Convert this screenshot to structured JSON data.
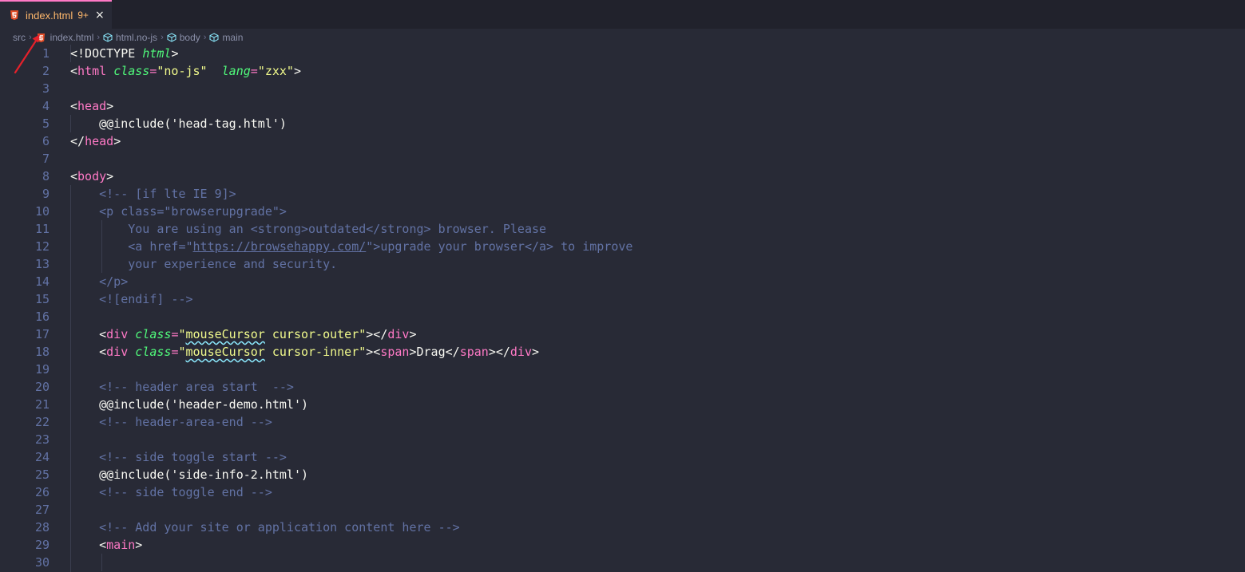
{
  "tab": {
    "label": "index.html",
    "badge": "9+",
    "close": "×"
  },
  "breadcrumb": {
    "items": [
      "src",
      "index.html",
      "html.no-js",
      "body",
      "main"
    ]
  },
  "colors": {
    "accent": "#ff79c6",
    "tab_text": "#ffb86c",
    "background": "#282a36",
    "arrow": "#e5212b"
  },
  "editor": {
    "lines": [
      [
        {
          "t": "<!DOCTYPE ",
          "c": "pun"
        },
        {
          "t": "html",
          "c": "doct"
        },
        {
          "t": ">",
          "c": "pun"
        }
      ],
      [
        {
          "t": "<",
          "c": "pun"
        },
        {
          "t": "html",
          "c": "tag"
        },
        {
          "t": " ",
          "c": "pun"
        },
        {
          "t": "class",
          "c": "attr"
        },
        {
          "t": "=",
          "c": "tag"
        },
        {
          "t": "\"no-js\"",
          "c": "str"
        },
        {
          "t": "  ",
          "c": "pun"
        },
        {
          "t": "lang",
          "c": "attr"
        },
        {
          "t": "=",
          "c": "tag"
        },
        {
          "t": "\"zxx\"",
          "c": "str"
        },
        {
          "t": ">",
          "c": "pun"
        }
      ],
      [],
      [
        {
          "t": "<",
          "c": "pun"
        },
        {
          "t": "head",
          "c": "tag"
        },
        {
          "t": ">",
          "c": "pun"
        }
      ],
      [
        {
          "t": "    @@include('head-tag.html')",
          "c": "plain"
        }
      ],
      [
        {
          "t": "</",
          "c": "pun"
        },
        {
          "t": "head",
          "c": "tag"
        },
        {
          "t": ">",
          "c": "pun"
        }
      ],
      [],
      [
        {
          "t": "<",
          "c": "pun"
        },
        {
          "t": "body",
          "c": "tag"
        },
        {
          "t": ">",
          "c": "pun"
        }
      ],
      [
        {
          "t": "    <!-- [if lte IE 9]>",
          "c": "com"
        }
      ],
      [
        {
          "t": "    <p class=\"browserupgrade\">",
          "c": "com"
        }
      ],
      [
        {
          "t": "        You are using an <strong>outdated</strong> browser. Please",
          "c": "com"
        }
      ],
      [
        {
          "t": "        <a href=\"",
          "c": "com"
        },
        {
          "t": "https://browsehappy.com/",
          "c": "link"
        },
        {
          "t": "\">upgrade your browser</a> to improve",
          "c": "com"
        }
      ],
      [
        {
          "t": "        your experience and security.",
          "c": "com"
        }
      ],
      [
        {
          "t": "    </p>",
          "c": "com"
        }
      ],
      [
        {
          "t": "    <![endif] -->",
          "c": "com"
        }
      ],
      [],
      [
        {
          "t": "    <",
          "c": "pun"
        },
        {
          "t": "div",
          "c": "tag"
        },
        {
          "t": " ",
          "c": "pun"
        },
        {
          "t": "class",
          "c": "attr"
        },
        {
          "t": "=",
          "c": "tag"
        },
        {
          "t": "\"",
          "c": "str"
        },
        {
          "t": "mouseCursor",
          "c": "str squig"
        },
        {
          "t": " cursor-outer\"",
          "c": "str"
        },
        {
          "t": "></",
          "c": "pun"
        },
        {
          "t": "div",
          "c": "tag"
        },
        {
          "t": ">",
          "c": "pun"
        }
      ],
      [
        {
          "t": "    <",
          "c": "pun"
        },
        {
          "t": "div",
          "c": "tag"
        },
        {
          "t": " ",
          "c": "pun"
        },
        {
          "t": "class",
          "c": "attr"
        },
        {
          "t": "=",
          "c": "tag"
        },
        {
          "t": "\"",
          "c": "str"
        },
        {
          "t": "mouseCursor",
          "c": "str squig"
        },
        {
          "t": " cursor-inner\"",
          "c": "str"
        },
        {
          "t": "><",
          "c": "pun"
        },
        {
          "t": "span",
          "c": "tag"
        },
        {
          "t": ">Drag</",
          "c": "pun"
        },
        {
          "t": "span",
          "c": "tag"
        },
        {
          "t": "></",
          "c": "pun"
        },
        {
          "t": "div",
          "c": "tag"
        },
        {
          "t": ">",
          "c": "pun"
        }
      ],
      [],
      [
        {
          "t": "    <!-- header area start  -->",
          "c": "com"
        }
      ],
      [
        {
          "t": "    @@include('header-demo.html')",
          "c": "plain"
        }
      ],
      [
        {
          "t": "    <!-- header-area-end -->",
          "c": "com"
        }
      ],
      [],
      [
        {
          "t": "    <!-- side toggle start -->",
          "c": "com"
        }
      ],
      [
        {
          "t": "    @@include('side-info-2.html')",
          "c": "plain"
        }
      ],
      [
        {
          "t": "    <!-- side toggle end -->",
          "c": "com"
        }
      ],
      [],
      [
        {
          "t": "    <!-- Add your site or application content here -->",
          "c": "com"
        }
      ],
      [
        {
          "t": "    <",
          "c": "pun"
        },
        {
          "t": "main",
          "c": "tag"
        },
        {
          "t": ">",
          "c": "pun"
        }
      ],
      []
    ]
  }
}
